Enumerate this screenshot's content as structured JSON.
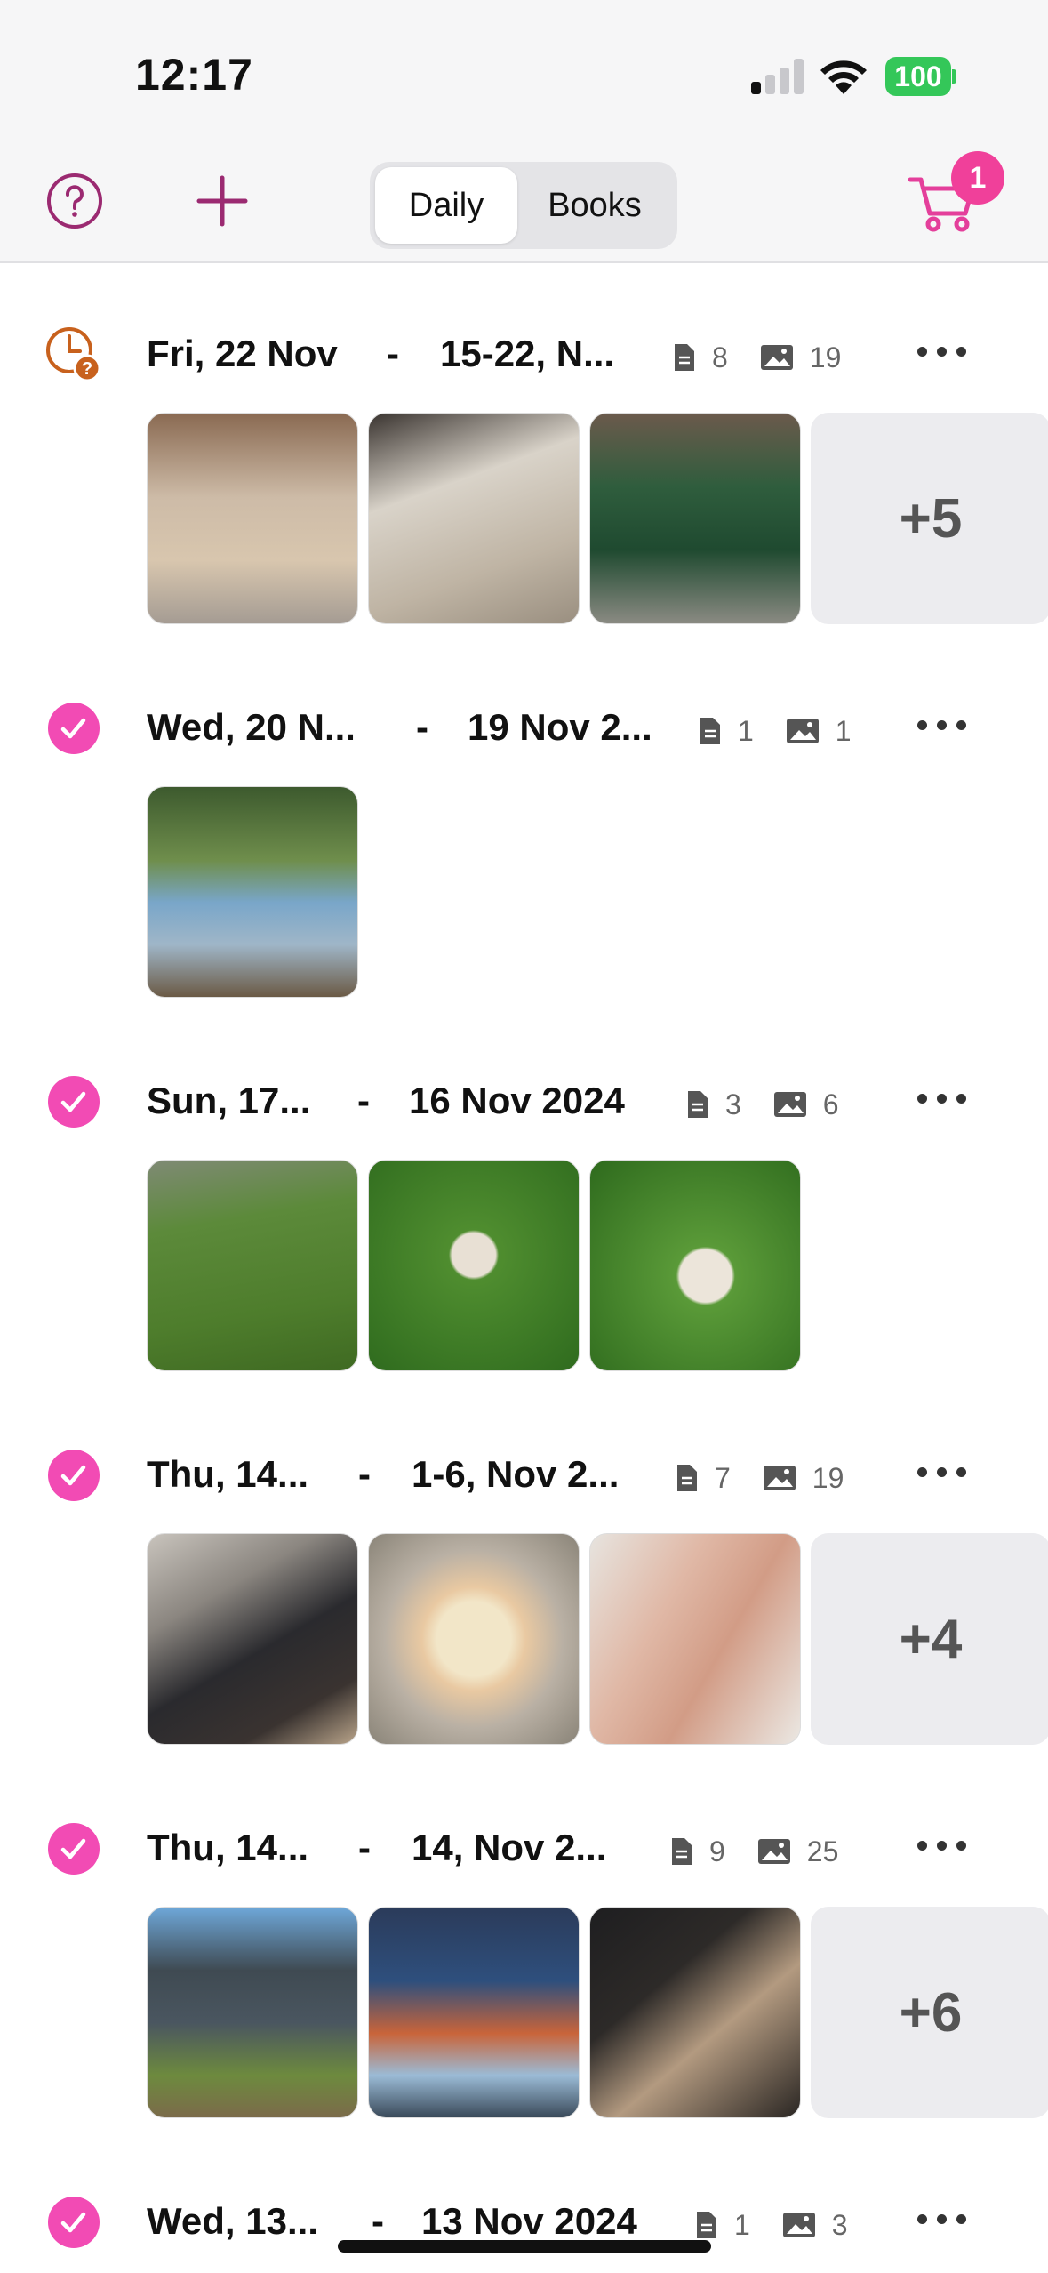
{
  "status_bar": {
    "time": "12:17",
    "battery": "100"
  },
  "nav": {
    "segments": [
      {
        "label": "Daily",
        "selected": true
      },
      {
        "label": "Books",
        "selected": false
      }
    ],
    "cart_count": "1",
    "icons": [
      "help-icon",
      "plus-icon",
      "cart-icon"
    ]
  },
  "colors": {
    "accent": "#f24bb4",
    "accent_dark": "#9b2a71",
    "pending": "#c8611d",
    "battery": "#34c759"
  },
  "entries": [
    {
      "status": "pending",
      "date": "Fri, 22 Nov",
      "range": "15-22, N...",
      "docs": "8",
      "photos": "19",
      "more": "+5",
      "thumbs": 3
    },
    {
      "status": "done",
      "date": "Wed, 20 N...",
      "range": "19 Nov 2...",
      "docs": "1",
      "photos": "1",
      "more": "",
      "thumbs": 1
    },
    {
      "status": "done",
      "date": "Sun, 17...",
      "range": "16 Nov 2024",
      "docs": "3",
      "photos": "6",
      "more": "",
      "thumbs": 3
    },
    {
      "status": "done",
      "date": "Thu, 14...",
      "range": "1-6, Nov 2...",
      "docs": "7",
      "photos": "19",
      "more": "+4",
      "thumbs": 3
    },
    {
      "status": "done",
      "date": "Thu, 14...",
      "range": "14, Nov 2...",
      "docs": "9",
      "photos": "25",
      "more": "+6",
      "thumbs": 3
    },
    {
      "status": "done",
      "date": "Wed, 13...",
      "range": "13 Nov 2024",
      "docs": "1",
      "photos": "3",
      "more": "",
      "thumbs": 0
    }
  ]
}
